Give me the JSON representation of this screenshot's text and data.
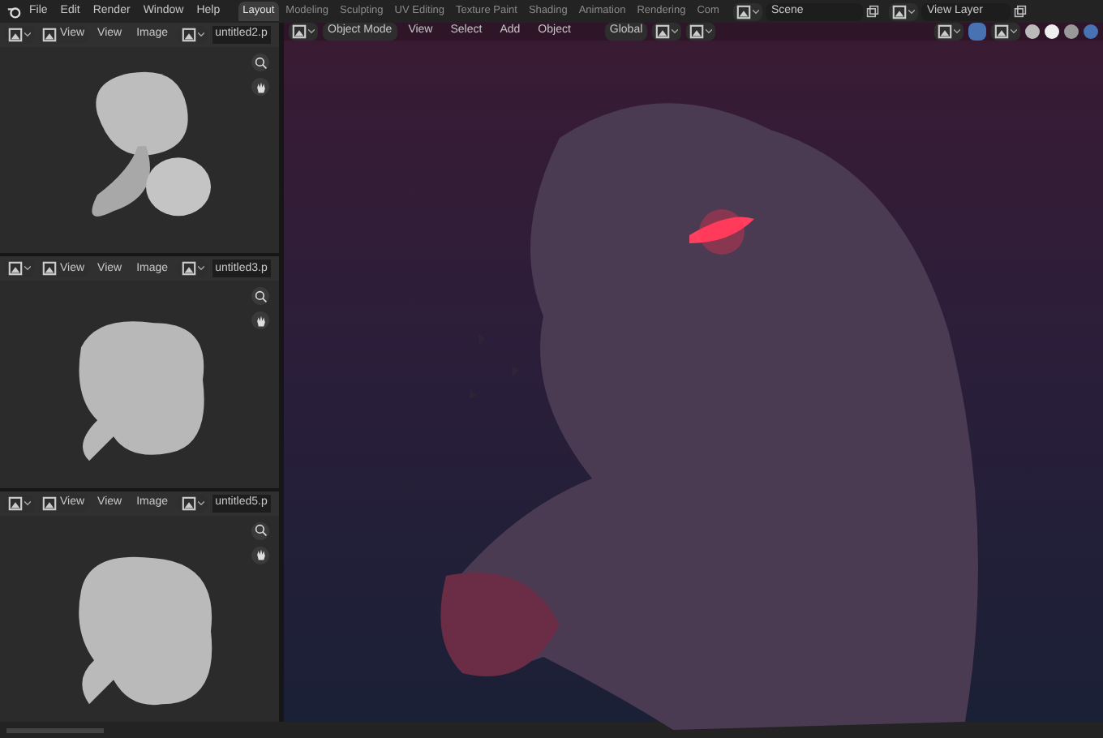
{
  "top_bar": {
    "menus": [
      "File",
      "Edit",
      "Render",
      "Window",
      "Help"
    ],
    "workspaces": [
      {
        "label": "Layout",
        "selected": true
      },
      {
        "label": "Modeling",
        "selected": false
      },
      {
        "label": "Sculpting",
        "selected": false
      },
      {
        "label": "UV Editing",
        "selected": false
      },
      {
        "label": "Texture Paint",
        "selected": false
      },
      {
        "label": "Shading",
        "selected": false
      },
      {
        "label": "Animation",
        "selected": false
      },
      {
        "label": "Rendering",
        "selected": false
      },
      {
        "label": "Com",
        "selected": false
      }
    ],
    "scene": "Scene",
    "view_layer": "View Layer"
  },
  "image_editors": [
    {
      "view_menu": "View",
      "menus": [
        "View",
        "Image"
      ],
      "image_name": "untitled2.p"
    },
    {
      "view_menu": "View",
      "menus": [
        "View",
        "Image"
      ],
      "image_name": "untitled3.p"
    },
    {
      "view_menu": "View",
      "menus": [
        "View",
        "Image"
      ],
      "image_name": "untitled5.p"
    }
  ],
  "viewport": {
    "mode": "Object Mode",
    "menus": [
      "View",
      "Select",
      "Add",
      "Object"
    ],
    "orientation": "Global"
  }
}
